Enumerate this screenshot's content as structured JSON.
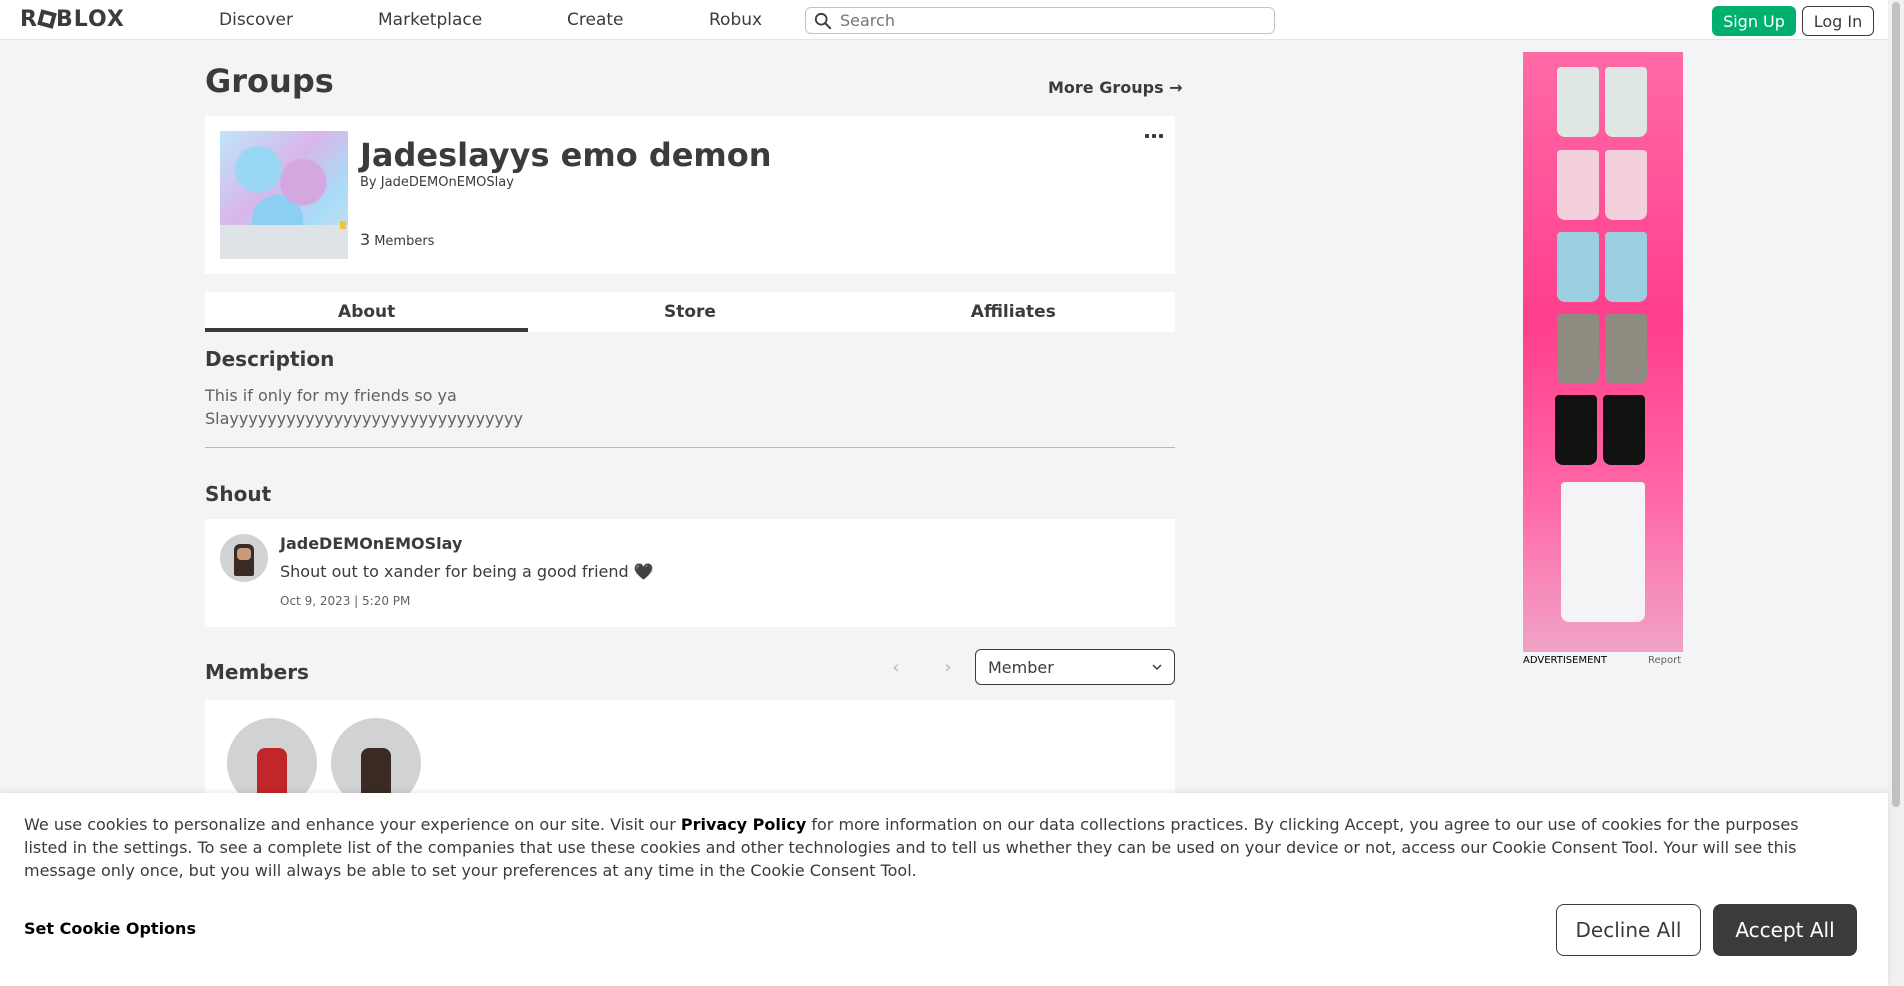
{
  "header": {
    "logo_text": "ROBLOX",
    "nav": [
      "Discover",
      "Marketplace",
      "Create",
      "Robux"
    ],
    "search_placeholder": "Search",
    "signup_label": "Sign Up",
    "login_label": "Log In"
  },
  "page": {
    "title": "Groups",
    "more_groups": "More Groups →"
  },
  "group": {
    "name": "Jadeslayys emo demon",
    "by_prefix": "By",
    "owner": "JadeDEMOnEMOSlay",
    "member_count": "3",
    "members_label": "Members"
  },
  "tabs": [
    "About",
    "Store",
    "Affiliates"
  ],
  "about": {
    "description_heading": "Description",
    "description_text": "This if only for my friends so ya\nSlayyyyyyyyyyyyyyyyyyyyyyyyyyyyyyy"
  },
  "shout": {
    "heading": "Shout",
    "user": "JadeDEMOnEMOSlay",
    "body": "Shout out to xander for being a good friend 🖤",
    "date": "Oct 9, 2023 | 5:20 PM"
  },
  "members": {
    "heading": "Members",
    "role_selected": "Member"
  },
  "ad": {
    "label": "ADVERTISEMENT",
    "report": "Report"
  },
  "cookie": {
    "text_before": "We use cookies to personalize and enhance your experience on our site. Visit our ",
    "privacy_link": "Privacy Policy",
    "text_after": " for more information on our data collections practices. By clicking Accept, you agree to our use of cookies for the purposes listed in the settings. To see a complete list of the companies that use these cookies and other technologies and to tell us whether they can be used on your device or not, access our Cookie Consent Tool. Your will see this message only once, but you will always be able to set your preferences at any time in the Cookie Consent Tool.",
    "options_label": "Set Cookie Options",
    "decline_label": "Decline All",
    "accept_label": "Accept All"
  },
  "colors": {
    "accent_green": "#00b06f",
    "text_dark": "#393b3d",
    "page_bg": "#f2f4f5"
  }
}
